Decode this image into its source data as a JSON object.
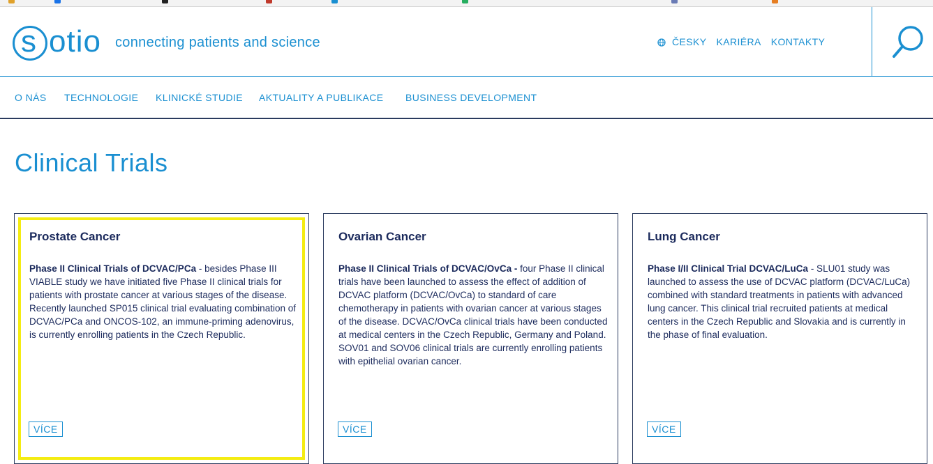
{
  "brand": {
    "logo_s": "s",
    "logo_rest": "otio",
    "tagline": "connecting patients and science"
  },
  "top_links": {
    "language": "ČESKY",
    "career": "KARIÉRA",
    "contacts": "KONTAKTY"
  },
  "nav": [
    "O NÁS",
    "TECHNOLOGIE",
    "KLINICKÉ STUDIE",
    "AKTUALITY A PUBLIKACE",
    "BUSINESS DEVELOPMENT"
  ],
  "page_title": "Clinical Trials",
  "cards": [
    {
      "title": "Prostate Cancer",
      "lead": "Phase II Clinical Trials of DCVAC/PCa",
      "body": " - besides Phase III VIABLE study we have initiated five Phase II clinical trials for patients with prostate cancer at various stages of the disease. Recently launched SP015 clinical trial evaluating combination of DCVAC/PCa and ONCOS-102, an immune-priming adenovirus, is currently enrolling patients in the Czech Republic.",
      "more": "VÍCE"
    },
    {
      "title": "Ovarian Cancer",
      "lead": "Phase II Clinical Trials of DCVAC/OvCa -",
      "body": " four Phase II clinical trials have been launched to assess the effect of addition of DCVAC platform (DCVAC/OvCa) to standard of care chemotherapy in patients with ovarian cancer at various stages of the disease. DCVAC/OvCa clinical trials have been conducted at medical centers in the Czech Republic, Germany and Poland. SOV01 and SOV06 clinical trials are currently enrolling patients with epithelial ovarian cancer.",
      "more": "VÍCE"
    },
    {
      "title": "Lung Cancer",
      "lead": "Phase I/II Clinical Trial DCVAC/LuCa",
      "body": " - SLU01 study was launched to assess the use of DCVAC platform (DCVAC/LuCa) combined with standard treatments in patients with advanced lung cancer. This clinical trial recruited patients at medical centers in the Czech Republic and Slovakia and is currently in the phase of final evaluation.",
      "more": "VÍCE"
    }
  ],
  "colors": {
    "accent": "#1a8fd1",
    "text": "#1b2a5c",
    "border": "#2a3a5e",
    "highlight": "#f4ec12"
  }
}
